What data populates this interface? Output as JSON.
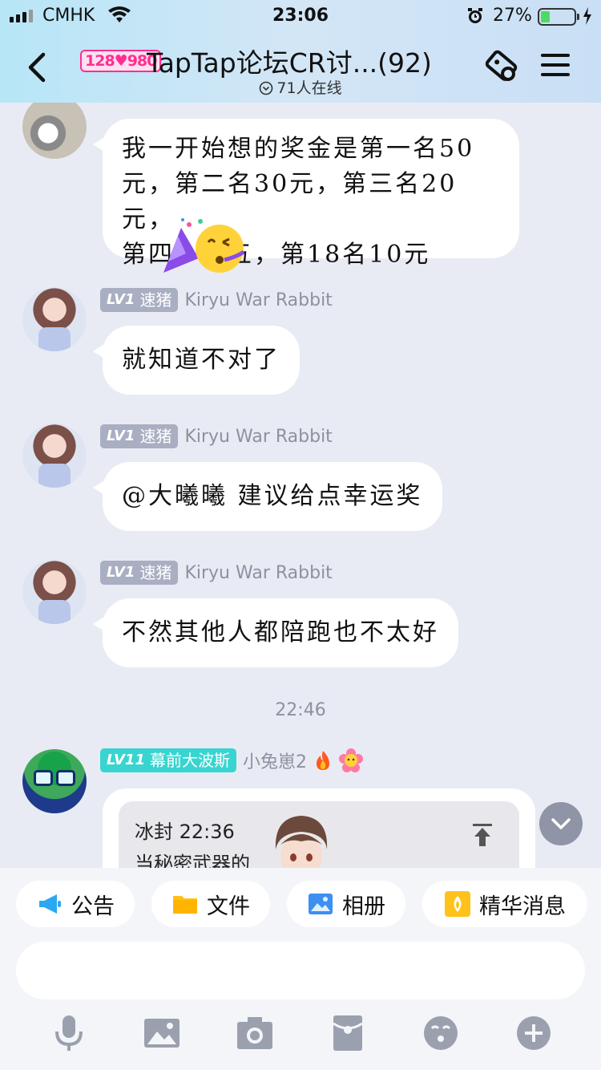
{
  "status_bar": {
    "carrier": "CMHK",
    "time": "23:06",
    "battery": "27%",
    "battery_level": 0.27
  },
  "header": {
    "group_badge": "128♥980",
    "title": "TapTap论坛CR讨...(92)",
    "online": "71人在线",
    "icons": [
      "back-icon",
      "tag-icon",
      "menu-icon"
    ]
  },
  "messages": [
    {
      "id": "m0",
      "text_lines": [
        "我一开始想的奖金是第一名50",
        "元，第二名30元，第三名20元，",
        "第四，第五，第18名10元"
      ],
      "sticker": "party-emoji"
    },
    {
      "id": "m1",
      "level": "LV1",
      "title": "速猪",
      "nickname": "Kiryu War Rabbit",
      "text": "就知道不对了"
    },
    {
      "id": "m2",
      "level": "LV1",
      "title": "速猪",
      "nickname": "Kiryu War Rabbit",
      "text": "@大曦曦 建议给点幸运奖"
    },
    {
      "id": "m3",
      "level": "LV1",
      "title": "速猪",
      "nickname": "Kiryu War Rabbit",
      "text": "不然其他人都陪跑也不太好"
    }
  ],
  "time_separator": "22:46",
  "last_message": {
    "level": "LV11",
    "title": "幕前大波斯",
    "nickname": "小兔崽2",
    "quote_line1": "冰封 22:36",
    "quote_line2": "当秘密武器的"
  },
  "quick_actions": [
    {
      "label": "公告",
      "icon": "megaphone-icon",
      "color": "#2aa8f2"
    },
    {
      "label": "文件",
      "icon": "folder-icon",
      "color": "#ffc21a"
    },
    {
      "label": "相册",
      "icon": "album-icon",
      "color": "#3d8ff2"
    },
    {
      "label": "精华消息",
      "icon": "essence-icon",
      "color": "#ffc21a"
    }
  ],
  "input": {
    "placeholder": ""
  },
  "toolbar": [
    "microphone-icon",
    "image-icon",
    "camera-icon",
    "red-packet-icon",
    "emoji-icon",
    "plus-icon"
  ],
  "colors": {
    "accent_teal": "#38d5d0",
    "badge_gray": "#a9aec2",
    "bubble": "#ffffff",
    "background": "#e9ebf4"
  }
}
